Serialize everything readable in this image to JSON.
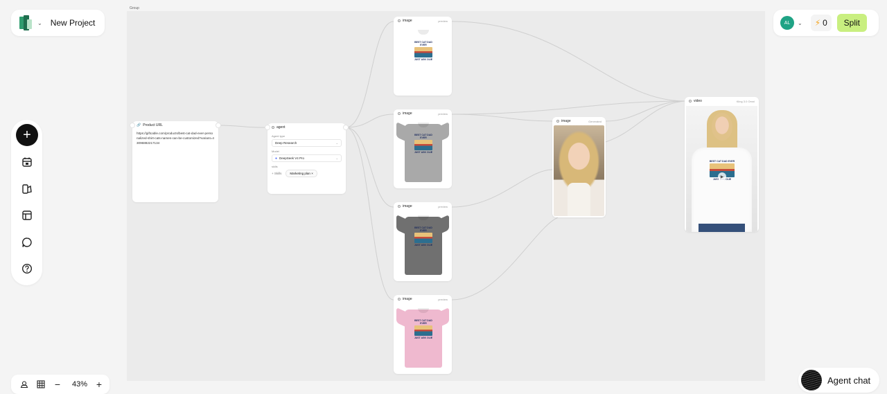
{
  "project": {
    "name": "New Project"
  },
  "user": {
    "initials": "AL",
    "credits": "0",
    "split_label": "Split"
  },
  "canvas": {
    "group_label": "Group",
    "zoom": "43%"
  },
  "agent_chat": {
    "label": "Agent chat"
  },
  "nodes": {
    "product_url": {
      "title": "Product URL",
      "url": "https://giftcable.com/products/best-cat-dad-ever-personalized-shirt-cats-names-can-be-customized?variant=43096882217134"
    },
    "agent": {
      "title": "agent",
      "agent_type_label": "Agent type",
      "agent_type_value": "Deep Research",
      "model_label": "Model",
      "model_value": "DeepSeek V4 Pro",
      "skills_label": "skills",
      "skills_add": "Skills",
      "skill_chip": "Marketing plan"
    },
    "image_nodes": [
      {
        "title": "image",
        "tag": "preview",
        "shirt_color": "#ffffff"
      },
      {
        "title": "image",
        "tag": "preview",
        "shirt_color": "#a9a9a9"
      },
      {
        "title": "image",
        "tag": "preview",
        "shirt_color": "#707070"
      },
      {
        "title": "image",
        "tag": "preview",
        "shirt_color": "#efb9cf"
      }
    ],
    "print": {
      "line1": "BEST CAT DAD EVER",
      "line2": "JUST ASK OLIE"
    },
    "portrait": {
      "title": "image",
      "tag": "Generated"
    },
    "video": {
      "title": "video",
      "tag": "Kling 3.0 Omni"
    }
  }
}
